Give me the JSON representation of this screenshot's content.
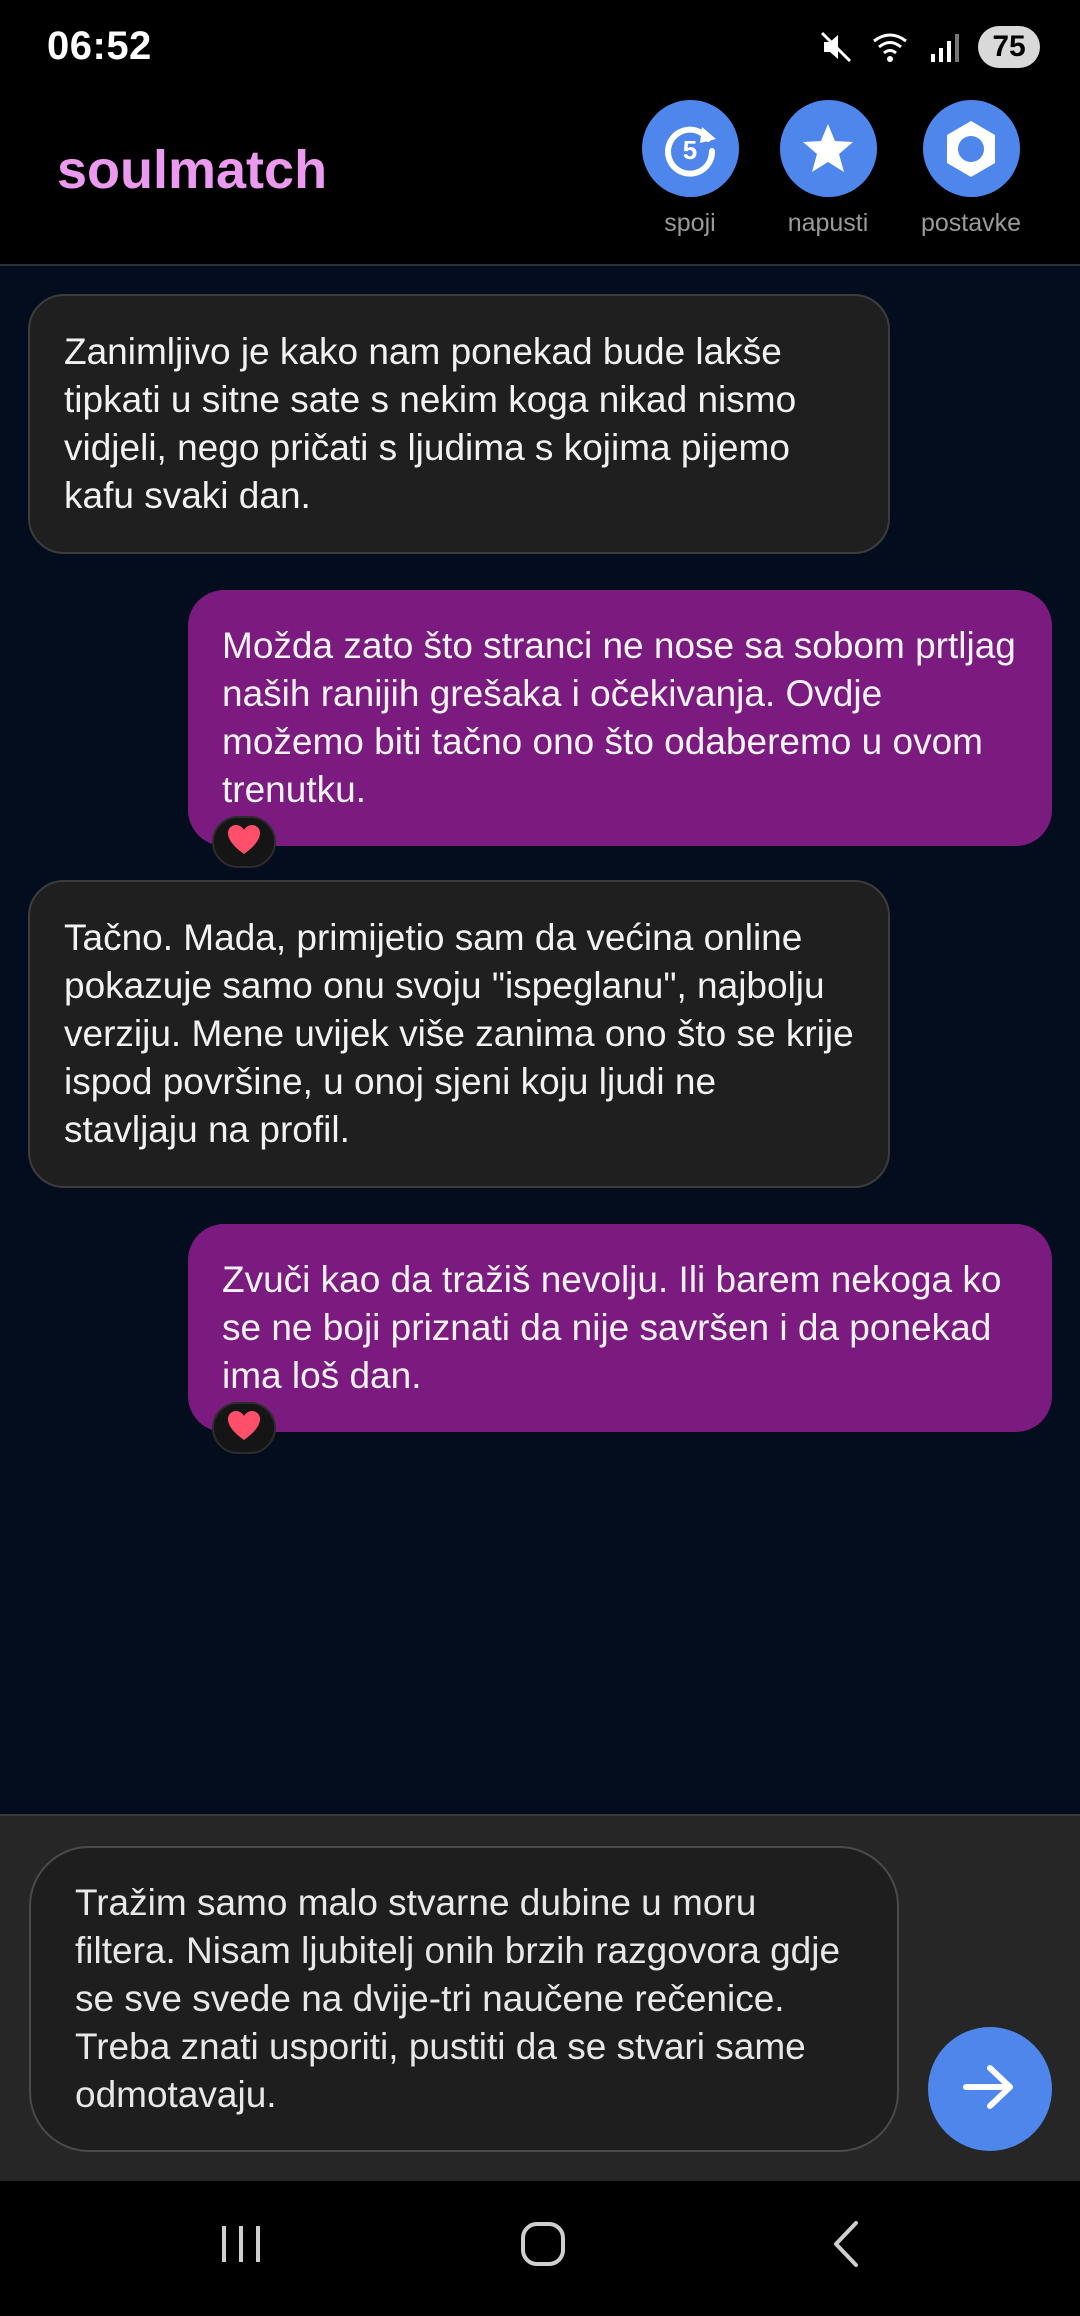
{
  "status_bar": {
    "time": "06:52",
    "battery": "75",
    "icons": [
      "mute-icon",
      "wifi-icon",
      "signal-icon"
    ]
  },
  "header": {
    "title": "soulmatch",
    "title_color": "#ec9af0",
    "accent_color": "#4e86ec",
    "buttons": [
      {
        "label": "spoji",
        "icon": "rematch-icon",
        "badge": "5"
      },
      {
        "label": "napusti",
        "icon": "star-icon"
      },
      {
        "label": "postavke",
        "icon": "gear-icon"
      }
    ]
  },
  "messages": [
    {
      "direction": "incoming",
      "text": "Zanimljivo je kako nam ponekad bude lakše tipkati u sitne sate s nekim koga nikad nismo vidjeli, nego pričati s ljudima s kojima pijemo kafu svaki dan."
    },
    {
      "direction": "outgoing",
      "text": "Možda zato što stranci ne nose sa sobom prtljag naših ranijih grešaka i očekivanja. Ovdje možemo biti tačno ono što odaberemo u ovom trenutku.",
      "reaction": "heart-icon"
    },
    {
      "direction": "incoming",
      "text": "Tačno. Mada, primijetio sam da većina online pokazuje samo onu svoju \"ispeglanu\", najbolju verziju. Mene uvijek više zanima ono što se krije ispod površine, u onoj sjeni koju ljudi ne stavljaju na profil."
    },
    {
      "direction": "outgoing",
      "text": "Zvuči kao da tražiš nevolju. Ili barem nekoga ko se ne boji priznati da nije savršen i da ponekad ima loš dan.",
      "reaction": "heart-icon"
    }
  ],
  "colors": {
    "incoming_bubble": "#1f1f1f",
    "outgoing_bubble": "#7b1a7f",
    "chat_background": "#030d1d"
  },
  "composer": {
    "value": "Tražim samo malo stvarne dubine u moru filtera. Nisam ljubitelj onih brzih razgovora gdje se sve svede na dvije-tri naučene rečenice. Treba znati usporiti, pustiti da se stvari same odmotavaju.",
    "send_icon": "send-arrow-icon"
  },
  "nav_bar": {
    "buttons": [
      "recents-icon",
      "home-icon",
      "back-icon"
    ]
  }
}
